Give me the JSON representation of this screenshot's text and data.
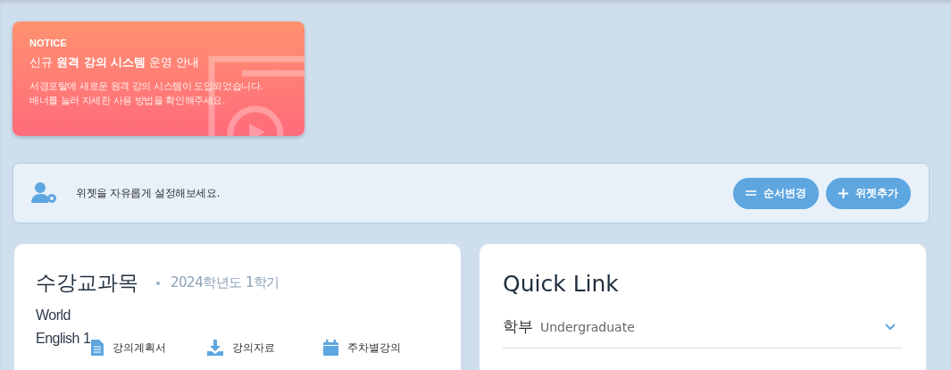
{
  "notice": {
    "label": "NOTICE",
    "title": "신규 **원격 강의 시스템** 운영 안내",
    "body": [
      "서경포탈에 새로운 원격 강의 시스템이 도입되었습니다.",
      "배너를 눌러 자세한 사용 방법을 확인해주세요."
    ]
  },
  "widget_bar": {
    "message": "위젯을 자유롭게 설정해보세요.",
    "buttons": [
      {
        "kind": "reorder",
        "label": "순서변경"
      },
      {
        "kind": "add",
        "label": "위젯추가"
      }
    ]
  },
  "courses": {
    "title": "수강교과목",
    "term": "2024학년도 1학기",
    "items": [
      {
        "name": "World English 1",
        "links": [
          {
            "kind": "document",
            "label": "강의계획서"
          },
          {
            "kind": "download",
            "label": "강의자료"
          },
          {
            "kind": "calendar",
            "label": "주차별강의"
          }
        ]
      }
    ]
  },
  "quick_link": {
    "title": "Quick Link",
    "items": [
      {
        "label": "학부",
        "sublabel": "Undergraduate",
        "expanded": false
      }
    ]
  }
}
